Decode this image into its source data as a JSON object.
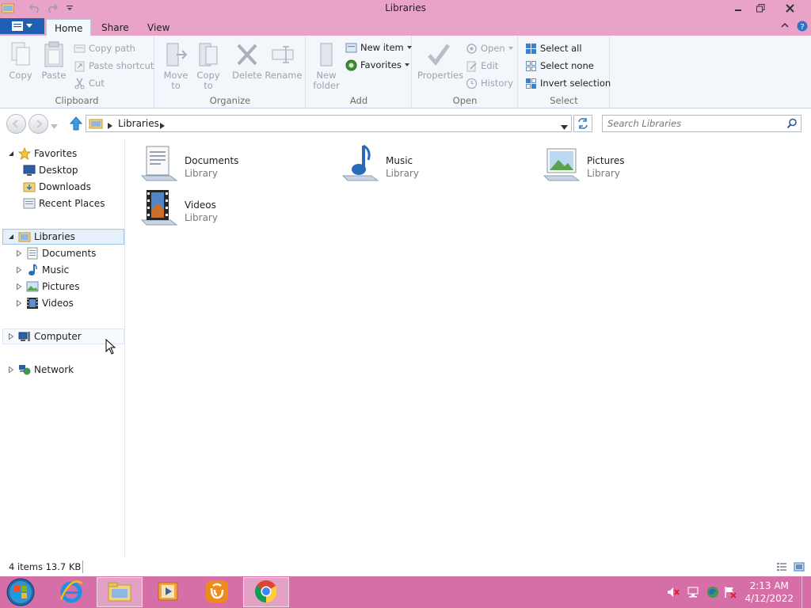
{
  "window": {
    "title": "Libraries"
  },
  "ribbon_tabs": {
    "file_label": "",
    "home": "Home",
    "share": "Share",
    "view": "View"
  },
  "ribbon": {
    "clipboard": {
      "label": "Clipboard",
      "copy": "Copy",
      "paste": "Paste",
      "copy_path": "Copy path",
      "paste_shortcut": "Paste shortcut",
      "cut": "Cut"
    },
    "organize": {
      "label": "Organize",
      "move_to_1": "Move",
      "move_to_2": "to",
      "copy_to_1": "Copy",
      "copy_to_2": "to",
      "delete": "Delete",
      "rename": "Rename"
    },
    "add": {
      "label": "Add",
      "new_folder_1": "New",
      "new_folder_2": "folder",
      "new_item": "New item",
      "favorites": "Favorites"
    },
    "open": {
      "label": "Open",
      "properties": "Properties",
      "open": "Open",
      "edit": "Edit",
      "history": "History"
    },
    "select": {
      "label": "Select",
      "select_all": "Select all",
      "select_none": "Select none",
      "invert_selection": "Invert selection"
    }
  },
  "address": {
    "crumb": "Libraries",
    "search_placeholder": "Search Libraries"
  },
  "nav": {
    "favorites": "Favorites",
    "desktop": "Desktop",
    "downloads": "Downloads",
    "recent_places": "Recent Places",
    "libraries": "Libraries",
    "documents": "Documents",
    "music": "Music",
    "pictures": "Pictures",
    "videos": "Videos",
    "computer": "Computer",
    "network": "Network"
  },
  "libraries": [
    {
      "name": "Documents",
      "type": "Library"
    },
    {
      "name": "Music",
      "type": "Library"
    },
    {
      "name": "Pictures",
      "type": "Library"
    },
    {
      "name": "Videos",
      "type": "Library"
    }
  ],
  "status": {
    "summary": "4 items  13.7 KB"
  },
  "taskbar": {
    "time": "2:13 AM",
    "date": "4/12/2022"
  },
  "colors": {
    "titlebar": "#e9a3c8",
    "taskbar": "#d66fa8",
    "accent": "#1f5fb4"
  }
}
